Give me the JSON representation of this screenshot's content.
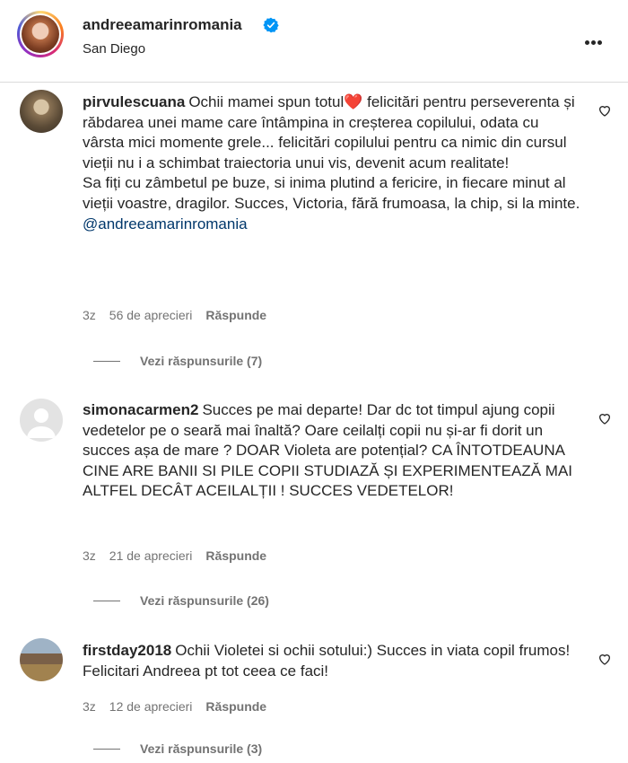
{
  "post_header": {
    "username": "andreeamarinromania",
    "location": "San Diego",
    "verified_icon": "verified-badge-icon",
    "more_icon": "more-options-icon"
  },
  "comments": [
    {
      "username": "pirvulescuana",
      "text_before_emoji": "Ochii mamei spun totul",
      "emoji": "❤️",
      "text_after_emoji": " felicitări pentru perseverenta și răbdarea unei mame care întâmpina in creșterea copilului, odata cu vârsta mici momente grele... felicitări copilului pentru ca nimic din cursul vieții nu i a schimbat traiectoria unui vis, devenit acum realitate!",
      "text_line2": "Sa fiți cu zâmbetul pe buze, si inima plutind a fericire, in fiecare minut al vieții voastre, dragilor. Succes, Victoria, fără frumoasa, la chip, si la minte.",
      "mention": "@andreeamarinromania",
      "time": "3z",
      "likes": "56 de aprecieri",
      "reply_label": "Răspunde",
      "view_replies": "Vezi răspunsurile (7)"
    },
    {
      "username": "simonacarmen2",
      "text": "Succes pe mai departe! Dar dc tot timpul ajung copii vedetelor pe o seară mai înaltă? Oare ceilalți copii nu și-ar fi dorit un succes așa de mare ? DOAR Violeta are potențial? CA ÎNTOTDEAUNA CINE ARE BANII SI PILE COPII STUDIAZĂ ȘI EXPERIMENTEAZĂ MAI ALTFEL DECÂT ACEILALȚII ! SUCCES VEDETELOR!",
      "time": "3z",
      "likes": "21 de aprecieri",
      "reply_label": "Răspunde",
      "view_replies": "Vezi răspunsurile (26)"
    },
    {
      "username": "firstday2018",
      "text": "Ochii Violetei si ochii sotului:) Succes in viata copil frumos! Felicitari Andreea pt tot ceea ce faci!",
      "time": "3z",
      "likes": "12 de aprecieri",
      "reply_label": "Răspunde",
      "view_replies": "Vezi răspunsurile (3)"
    }
  ],
  "colors": {
    "text": "#262626",
    "secondary": "#737373",
    "link": "#00376b",
    "verified": "#0095f6",
    "heart": "#e0245e"
  }
}
